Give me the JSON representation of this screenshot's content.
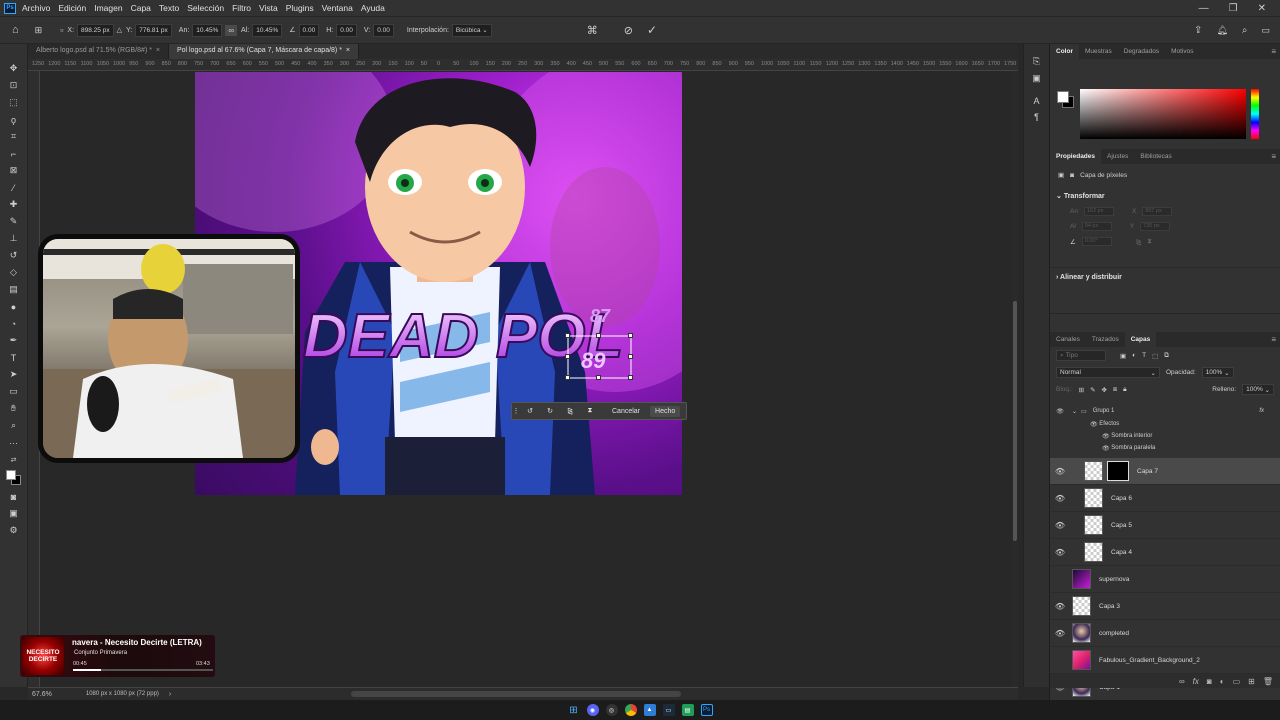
{
  "app": {
    "logo": "Ps"
  },
  "menu": [
    "Archivo",
    "Edición",
    "Imagen",
    "Capa",
    "Texto",
    "Selección",
    "Filtro",
    "Vista",
    "Plugins",
    "Ventana",
    "Ayuda"
  ],
  "window_controls": {
    "minimize": "—",
    "restore": "❐",
    "close": "✕"
  },
  "options": {
    "x_label": "X:",
    "x_value": "898.25 px",
    "y_label": "Y:",
    "y_value": "776.81 px",
    "w_label": "An:",
    "w_value": "10.45%",
    "h_label": "Al:",
    "h_value": "10.45%",
    "angle_value": "0.00",
    "hskew_label": "H:",
    "hskew_value": "0.00",
    "vskew_label": "V:",
    "vskew_value": "0.00",
    "interp_label": "Interpolación:",
    "interp_value": "Bicúbica"
  },
  "tabs": [
    {
      "label": "Alberto logo.psd al 71.5% (RGB/8#) *",
      "close": "×"
    },
    {
      "label": "Pol logo.psd al 67.6% (Capa 7, Máscara de capa/8) *",
      "close": "×"
    }
  ],
  "ruler_ticks": [
    "1250",
    "1200",
    "1150",
    "1100",
    "1050",
    "1000",
    "950",
    "900",
    "850",
    "800",
    "750",
    "700",
    "650",
    "600",
    "550",
    "500",
    "450",
    "400",
    "350",
    "300",
    "250",
    "200",
    "150",
    "100",
    "50",
    "0",
    "50",
    "100",
    "150",
    "200",
    "250",
    "300",
    "350",
    "400",
    "450",
    "500",
    "550",
    "600",
    "650",
    "700",
    "750",
    "800",
    "850",
    "900",
    "950",
    "1000",
    "1050",
    "1100",
    "1150",
    "1200",
    "1250",
    "1300",
    "1350",
    "1400",
    "1450",
    "1500",
    "1550",
    "1600",
    "1650",
    "1700",
    "1750"
  ],
  "artwork": {
    "title_text": "DEAD POL",
    "number_old": "87",
    "number_new": "89"
  },
  "transform_bar": {
    "cancel": "Cancelar",
    "done": "Hecho"
  },
  "status": {
    "zoom": "67.6%",
    "doc_info": "1080 px x 1080 px (72 ppp)"
  },
  "music": {
    "cover_text": "NECESITO DECIRTE",
    "title": "navera - Necesito Decirte (LETRA)",
    "artist": "Conjunto Primavera",
    "time_elapsed": "00:45",
    "time_total": "03:43",
    "progress": 0.2
  },
  "color_panel": {
    "tabs": [
      "Color",
      "Muestras",
      "Degradados",
      "Motivos"
    ],
    "fg": "#ffffff",
    "bg": "#000000"
  },
  "properties_panel": {
    "tabs": [
      "Propiedades",
      "Ajustes",
      "Bibliotecas"
    ],
    "layer_type": "Capa de píxeles",
    "transform_title": "Transformar",
    "an_label": "An",
    "an_value": "162 px",
    "x_label": "X",
    "x_value": "807 px",
    "al_label": "Al",
    "al_value": "94 px",
    "y_label": "Y",
    "y_value": "730 px",
    "angle_value": "0.00°",
    "align_title": "Alinear y distribuir"
  },
  "layers_panel": {
    "tabs": [
      "Canales",
      "Trazados",
      "Capas"
    ],
    "filter_placeholder": "Tipo",
    "blend_mode": "Normal",
    "opacity_label": "Opacidad:",
    "opacity_value": "100%",
    "lock_label": "Bloq.:",
    "fill_label": "Relleno:",
    "fill_value": "100%",
    "group": {
      "name": "Grupo 1",
      "fx": "fx",
      "effects_label": "Efectos",
      "effects": [
        "Sombra interior",
        "Sombra paralela"
      ]
    },
    "layers": [
      {
        "name": "Capa 7",
        "visible": true,
        "thumb": "checker",
        "mask": true,
        "selected": true
      },
      {
        "name": "Capa 6",
        "visible": true,
        "thumb": "checker"
      },
      {
        "name": "Capa 5",
        "visible": true,
        "thumb": "checker"
      },
      {
        "name": "Capa 4",
        "visible": true,
        "thumb": "checker"
      },
      {
        "name": "supernova",
        "visible": false,
        "thumb": "purple"
      },
      {
        "name": "Capa 3",
        "visible": true,
        "thumb": "checker"
      },
      {
        "name": "completed",
        "visible": true,
        "thumb": "char"
      },
      {
        "name": "Fabulous_Gradient_Background_2",
        "visible": false,
        "thumb": "gradient"
      },
      {
        "name": "Capa 1",
        "visible": true,
        "thumb": "char"
      }
    ]
  },
  "colors": {
    "accent": "#31a8ff",
    "canvas_bg": "#282828",
    "panel_bg": "#323232"
  }
}
